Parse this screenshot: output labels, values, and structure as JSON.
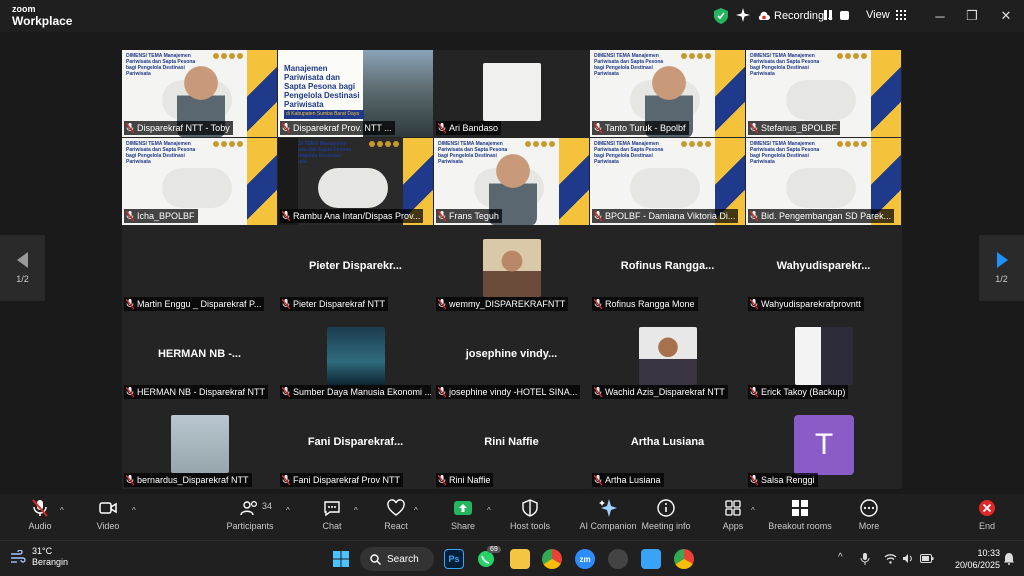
{
  "app": {
    "logo_line1": "zoom",
    "logo_line2": "Workplace"
  },
  "titlebar": {
    "recording": "Recording...",
    "view": "View"
  },
  "pager": {
    "left": "1/2",
    "right": "1/2"
  },
  "slide_text": {
    "header": "DIMENSI TEMA Manajemen Pariwisata dan Sapta Pesona bagi Pengelola Destinasi Pariwisata",
    "poster_title": "Manajemen Pariwisata dan Sapta Pesona bagi Pengelola Destinasi Pariwisata",
    "poster_band": "di Kabupaten Sumba Barat Daya"
  },
  "participants": [
    {
      "label": "Disparekraf NTT - Toby",
      "kind": "slide-person"
    },
    {
      "label": "Disparekraf Prov. NTT ...",
      "kind": "poster"
    },
    {
      "label": "Ari Bandaso",
      "kind": "blank"
    },
    {
      "label": "Tanto Turuk - Bpolbf",
      "kind": "slide-person"
    },
    {
      "label": "Stefanus_BPOLBF",
      "kind": "slide"
    },
    {
      "label": "Icha_BPOLBF",
      "kind": "slide"
    },
    {
      "label": "Rambu Ana Intan/Dispas Prov...",
      "kind": "slide-dark"
    },
    {
      "label": "Frans Teguh",
      "kind": "slide-person",
      "active": true
    },
    {
      "label": "BPOLBF - Damiana Viktoria Di...",
      "kind": "slide"
    },
    {
      "label": "Bid. Pengembangan SD Parek...",
      "kind": "slide"
    },
    {
      "label": "Martin Enggu _ Disparekraf P...",
      "kind": "empty",
      "big": ""
    },
    {
      "label": "Pieter Disparekraf NTT",
      "kind": "name",
      "big": "Pieter  Disparekr..."
    },
    {
      "label": "wemmy_DISPAREKRAFNTT",
      "kind": "photo"
    },
    {
      "label": "Rofinus Rangga Mone",
      "kind": "name",
      "big": "Rofinus  Rangga..."
    },
    {
      "label": "Wahyudisparekrafprovntt",
      "kind": "name",
      "big": "Wahyudisparekr..."
    },
    {
      "label": "HERMAN NB - Disparekraf NTT",
      "kind": "name",
      "big": "HERMAN NB  -..."
    },
    {
      "label": "Sumber Daya Manusia Ekonomi ...",
      "kind": "photo-dark"
    },
    {
      "label": "josephine vindy -HOTEL SINA...",
      "kind": "name",
      "big": "josephine  vindy..."
    },
    {
      "label": "Wachid Azis_Disparekraf NTT",
      "kind": "photo-man"
    },
    {
      "label": "Erick Takoy (Backup)",
      "kind": "photo-couple"
    },
    {
      "label": "bernardus_Disparekraf NTT",
      "kind": "photo-fog"
    },
    {
      "label": "Fani Disparekraf Prov NTT",
      "kind": "name",
      "big": "Fani  Disparekraf..."
    },
    {
      "label": "Rini Naffie",
      "kind": "name",
      "big": "Rini Naffie"
    },
    {
      "label": "Artha Lusiana",
      "kind": "name",
      "big": "Artha Lusiana"
    },
    {
      "label": "Salsa Renggi",
      "kind": "avatar",
      "big": "T"
    }
  ],
  "toolbar": {
    "audio": "Audio",
    "video": "Video",
    "participants": "Participants",
    "participants_count": "34",
    "chat": "Chat",
    "react": "React",
    "share": "Share",
    "host_tools": "Host tools",
    "ai": "AI Companion",
    "meeting_info": "Meeting info",
    "apps": "Apps",
    "breakout": "Breakout rooms",
    "more": "More",
    "end": "End"
  },
  "taskbar": {
    "temp": "31°C",
    "weather": "Berangin",
    "search": "Search",
    "whatsapp_badge": "69",
    "time": "10:33",
    "date": "20/06/2025"
  },
  "colors": {
    "active_border": "#24b55e",
    "share_green": "#24b55e",
    "end_red": "#e02828",
    "avatar_purple": "#8b5cc7"
  }
}
